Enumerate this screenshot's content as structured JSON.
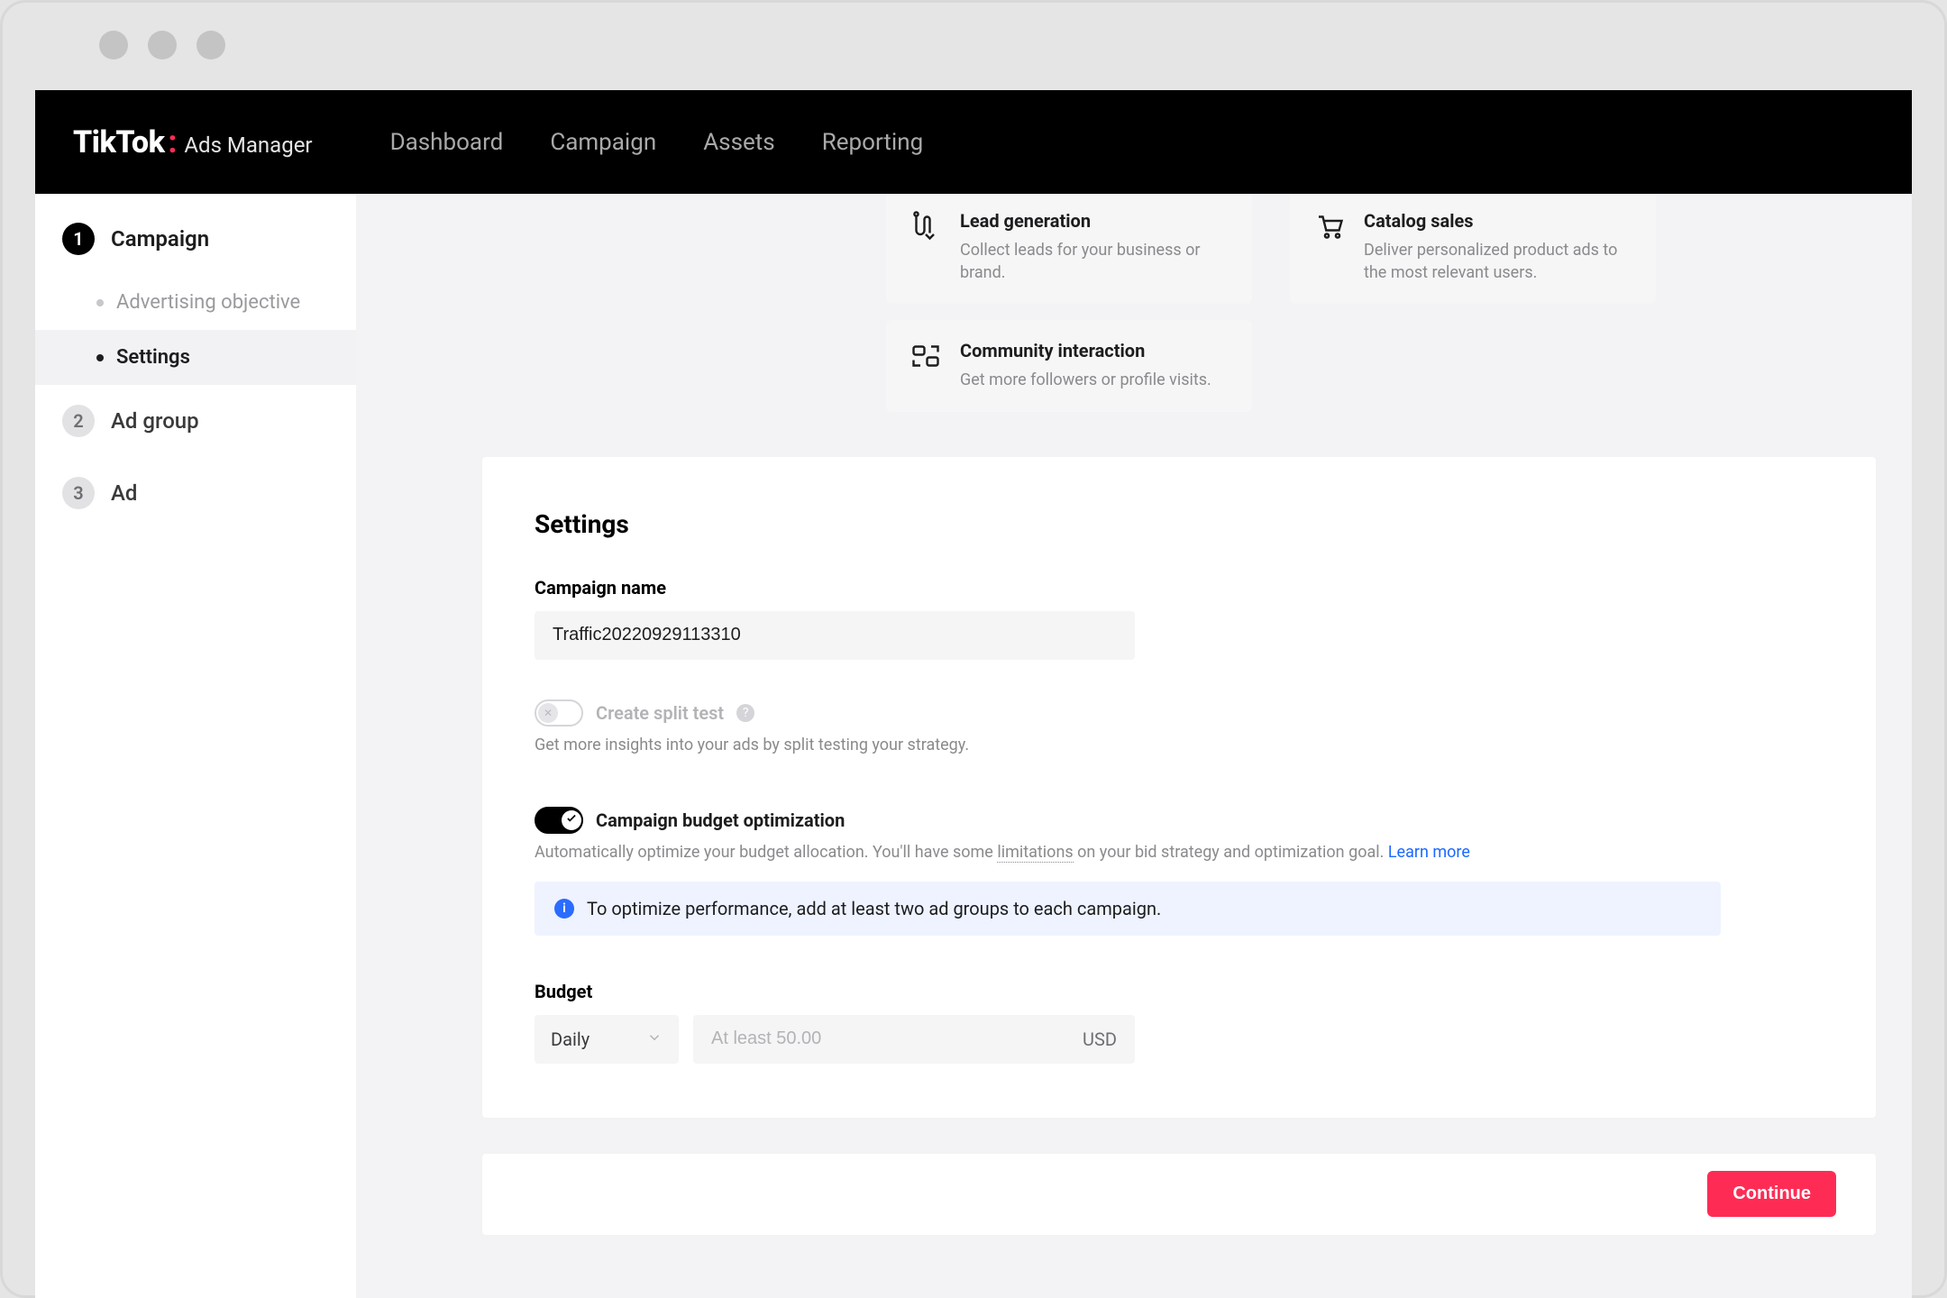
{
  "logo": {
    "mark": "TikTok",
    "sub": "Ads Manager"
  },
  "nav": {
    "dashboard": "Dashboard",
    "campaign": "Campaign",
    "assets": "Assets",
    "reporting": "Reporting"
  },
  "sidebar": {
    "steps": [
      {
        "num": "1",
        "label": "Campaign",
        "active": true
      },
      {
        "num": "2",
        "label": "Ad group",
        "active": false
      },
      {
        "num": "3",
        "label": "Ad",
        "active": false
      }
    ],
    "subs": [
      {
        "label": "Advertising objective",
        "active": false
      },
      {
        "label": "Settings",
        "active": true
      }
    ]
  },
  "objectives": {
    "lead": {
      "title": "Lead generation",
      "desc": "Collect leads for your business or brand."
    },
    "community": {
      "title": "Community interaction",
      "desc": "Get more followers or profile visits."
    },
    "catalog": {
      "title": "Catalog sales",
      "desc": "Deliver personalized product ads to the most relevant users."
    }
  },
  "settings": {
    "title": "Settings",
    "name_label": "Campaign name",
    "name_value": "Traffic20220929113310",
    "split": {
      "label": "Create split test",
      "help": "Get more insights into your ads by split testing your strategy."
    },
    "cbo": {
      "label": "Campaign budget optimization",
      "help_pre": "Automatically optimize your budget allocation. You'll have some ",
      "help_link_word": "limitations",
      "help_post": " on your bid strategy and optimization goal. ",
      "learn_more": "Learn more"
    },
    "info": "To optimize performance, add at least two ad groups to each campaign.",
    "budget": {
      "label": "Budget",
      "period": "Daily",
      "placeholder": "At least 50.00",
      "currency": "USD"
    }
  },
  "actions": {
    "continue": "Continue"
  }
}
